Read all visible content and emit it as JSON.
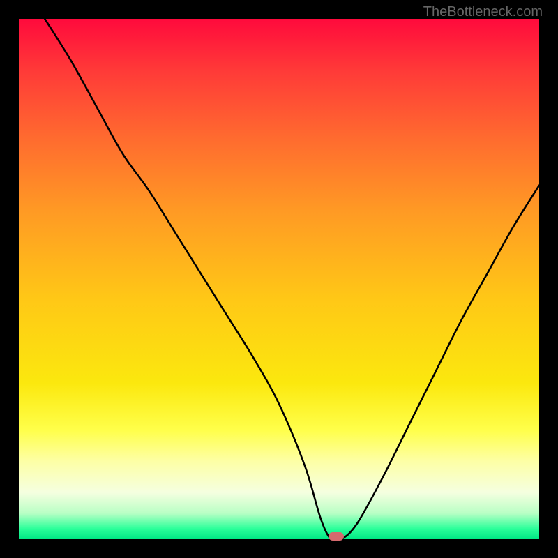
{
  "watermark": "TheBottleneck.com",
  "chart_data": {
    "type": "line",
    "title": "",
    "xlabel": "",
    "ylabel": "",
    "xlim": [
      0,
      100
    ],
    "ylim": [
      0,
      100
    ],
    "series": [
      {
        "name": "bottleneck-curve",
        "x": [
          5,
          10,
          15,
          20,
          25,
          30,
          35,
          40,
          45,
          50,
          55,
          58,
          60,
          62,
          65,
          70,
          75,
          80,
          85,
          90,
          95,
          100
        ],
        "y": [
          100,
          92,
          83,
          74,
          67,
          59,
          51,
          43,
          35,
          26,
          14,
          4,
          0,
          0,
          3,
          12,
          22,
          32,
          42,
          51,
          60,
          68
        ]
      }
    ],
    "marker": {
      "x": 61,
      "y": 0.5,
      "color": "#d66a6e"
    },
    "gradient_stops": [
      {
        "pct": 0,
        "color": "#ff0a3c"
      },
      {
        "pct": 10,
        "color": "#ff3a38"
      },
      {
        "pct": 23,
        "color": "#ff6b2f"
      },
      {
        "pct": 37,
        "color": "#ff9a24"
      },
      {
        "pct": 54,
        "color": "#ffc816"
      },
      {
        "pct": 70,
        "color": "#fbe80e"
      },
      {
        "pct": 79,
        "color": "#ffff4a"
      },
      {
        "pct": 85,
        "color": "#fdffa5"
      },
      {
        "pct": 91,
        "color": "#f5ffe0"
      },
      {
        "pct": 95,
        "color": "#b9ffc5"
      },
      {
        "pct": 98,
        "color": "#2bff9a"
      },
      {
        "pct": 100,
        "color": "#00e884"
      }
    ]
  }
}
